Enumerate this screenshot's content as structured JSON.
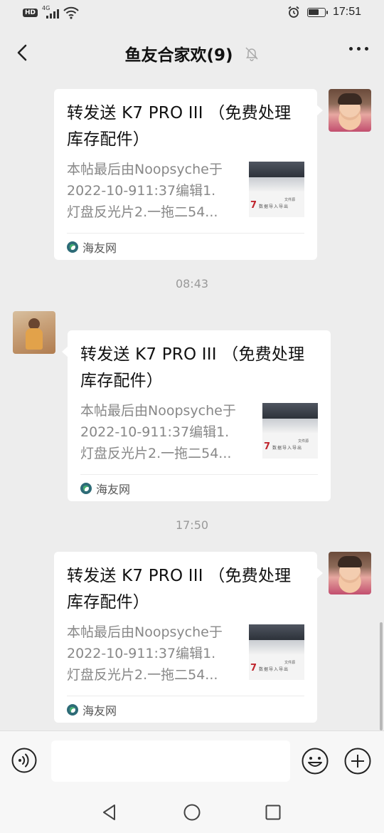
{
  "status_bar": {
    "network_badge": "HD",
    "network_type": "4G",
    "time": "17:51",
    "battery_level": 0.7
  },
  "nav": {
    "title": "鱼友合家欢(9)",
    "back_icon": "chevron-left-icon",
    "mute_icon": "bell-off-icon",
    "more_icon": "more-dots-icon"
  },
  "messages": [
    {
      "side": "right",
      "title": "转发送 K7 PRO III （免费处理库存配件）",
      "title_lines": [
        "转发送 K7 PRO III （免费处理",
        "库存配件）"
      ],
      "desc_lines": [
        "本帖最后由Noopsyche于",
        "2022-10-911:37编辑1.",
        "灯盘反光片2.一拖二54..."
      ],
      "source": "海友网"
    },
    {
      "side": "left",
      "timestamp": "08:43",
      "title_lines": [
        "转发送 K7 PRO III （免费处理",
        "库存配件）"
      ],
      "desc_lines": [
        "本帖最后由Noopsyche于",
        "2022-10-911:37编辑1.",
        "灯盘反光片2.一拖二54..."
      ],
      "source": "海友网"
    },
    {
      "side": "right",
      "timestamp": "17:50",
      "title_lines": [
        "转发送 K7 PRO III （免费处理",
        "库存配件）"
      ],
      "desc_lines": [
        "本帖最后由Noopsyche于",
        "2022-10-911:37编辑1.",
        "灯盘反光片2.一拖二54..."
      ],
      "source": "海友网"
    }
  ],
  "thumbnail": {
    "number": "7",
    "text_a": "数据导入导出",
    "text_b": "文件源"
  },
  "input_bar": {
    "placeholder": "",
    "voice_icon": "voice-icon",
    "emoji_icon": "emoji-icon",
    "plus_icon": "plus-circle-icon"
  },
  "system_nav": [
    "back-triangle-icon",
    "home-circle-icon",
    "recents-square-icon"
  ]
}
